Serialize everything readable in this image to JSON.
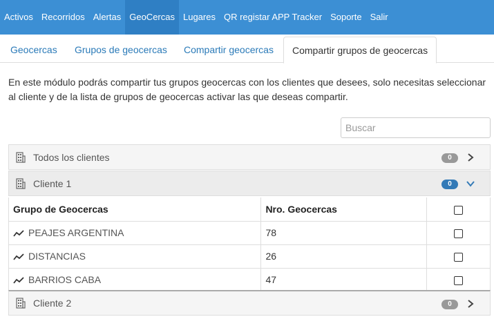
{
  "nav": {
    "items": [
      "Activos",
      "Recorridos",
      "Alertas",
      "GeoCercas",
      "Lugares",
      "QR registar APP Tracker",
      "Soporte",
      "Salir"
    ],
    "active_index": 3
  },
  "tabs": {
    "items": [
      "Geocercas",
      "Grupos de geocercas",
      "Compartir geocercas",
      "Compartir grupos de geocercas"
    ],
    "active_index": 3
  },
  "intro": "En este módulo podrás compartir tus grupos geocercas con los clientes que desees, solo necesitas seleccionar al cliente y de la lista de grupos de geocercas activar las que deseas compartir.",
  "search": {
    "placeholder": "Buscar",
    "value": ""
  },
  "clients": [
    {
      "label": "Todos los clientes",
      "count": "0",
      "expanded": false
    },
    {
      "label": "Cliente 1",
      "count": "0",
      "expanded": true
    },
    {
      "label": "Cliente 2",
      "count": "0",
      "expanded": false
    }
  ],
  "table": {
    "headers": [
      "Grupo de Geocercas",
      "Nro. Geocercas",
      ""
    ],
    "rows": [
      {
        "name": "PEAJES ARGENTINA",
        "count": "78",
        "checked": false
      },
      {
        "name": "DISTANCIAS",
        "count": "26",
        "checked": false
      },
      {
        "name": "BARRIOS CABA",
        "count": "47",
        "checked": false
      }
    ]
  },
  "colors": {
    "nav_bg": "#3c8fd4",
    "link": "#2a7ab8",
    "badge_grey": "#999999",
    "badge_blue": "#337ab7"
  },
  "icons": {
    "client": "building-icon",
    "group": "trend-line-icon",
    "collapsed": "chevron-right-icon",
    "expanded": "chevron-down-icon"
  }
}
